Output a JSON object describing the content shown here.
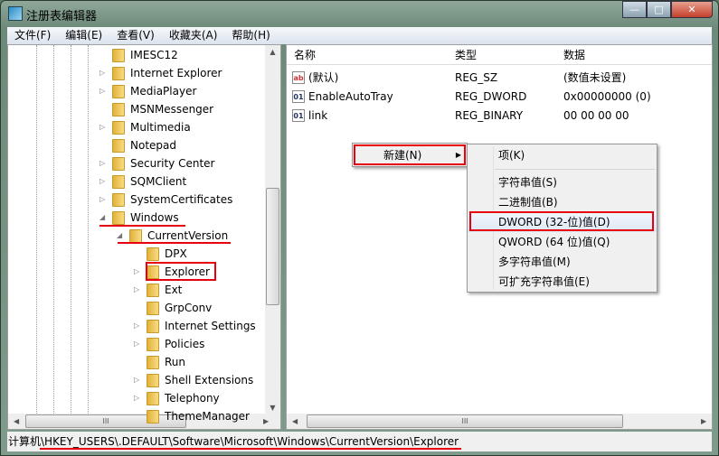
{
  "window": {
    "title": "注册表编辑器",
    "minimize": "—",
    "maximize": "□",
    "close": "✕"
  },
  "menubar": [
    "文件(F)",
    "编辑(E)",
    "查看(V)",
    "收藏夹(A)",
    "帮助(H)"
  ],
  "tree": [
    {
      "label": "IMESC12",
      "level": 0,
      "expander": ""
    },
    {
      "label": "Internet Explorer",
      "level": 0,
      "expander": "▷"
    },
    {
      "label": "MediaPlayer",
      "level": 0,
      "expander": "▷"
    },
    {
      "label": "MSNMessenger",
      "level": 0,
      "expander": ""
    },
    {
      "label": "Multimedia",
      "level": 0,
      "expander": "▷"
    },
    {
      "label": "Notepad",
      "level": 0,
      "expander": ""
    },
    {
      "label": "Security Center",
      "level": 0,
      "expander": "▷"
    },
    {
      "label": "SQMClient",
      "level": 0,
      "expander": "▷"
    },
    {
      "label": "SystemCertificates",
      "level": 0,
      "expander": "▷"
    },
    {
      "label": "Windows",
      "level": 0,
      "expander": "◢"
    },
    {
      "label": "CurrentVersion",
      "level": 1,
      "expander": "◢"
    },
    {
      "label": "DPX",
      "level": 2,
      "expander": ""
    },
    {
      "label": "Explorer",
      "level": 2,
      "expander": "▷"
    },
    {
      "label": "Ext",
      "level": 2,
      "expander": "▷"
    },
    {
      "label": "GrpConv",
      "level": 2,
      "expander": ""
    },
    {
      "label": "Internet Settings",
      "level": 2,
      "expander": "▷"
    },
    {
      "label": "Policies",
      "level": 2,
      "expander": "▷"
    },
    {
      "label": "Run",
      "level": 2,
      "expander": ""
    },
    {
      "label": "Shell Extensions",
      "level": 2,
      "expander": "▷"
    },
    {
      "label": "Telephony",
      "level": 2,
      "expander": "▷"
    },
    {
      "label": "ThemeManager",
      "level": 2,
      "expander": ""
    }
  ],
  "columns": {
    "name": "名称",
    "type": "类型",
    "data": "数据"
  },
  "values": [
    {
      "icon": "ab",
      "name": "(默认)",
      "type": "REG_SZ",
      "data": "(数值未设置)"
    },
    {
      "icon": "01",
      "name": "EnableAutoTray",
      "type": "REG_DWORD",
      "data": "0x00000000 (0)"
    },
    {
      "icon": "01",
      "name": "link",
      "type": "REG_BINARY",
      "data": "00 00 00 00"
    }
  ],
  "context_menu": {
    "new": "新建(N)",
    "arrow": "▶"
  },
  "submenu": [
    "项(K)",
    "字符串值(S)",
    "二进制值(B)",
    "DWORD (32-位)值(D)",
    "QWORD (64 位)值(Q)",
    "多字符串值(M)",
    "可扩充字符串值(E)"
  ],
  "status": {
    "path": "计算机\\HKEY_USERS\\.DEFAULT\\Software\\Microsoft\\Windows\\CurrentVersion\\Explorer"
  },
  "scroll": {
    "thumb_grip": "III",
    "up": "▲",
    "down": "▼",
    "left": "◀",
    "right": "▶"
  },
  "colors": {
    "highlight": "#e8000e"
  }
}
